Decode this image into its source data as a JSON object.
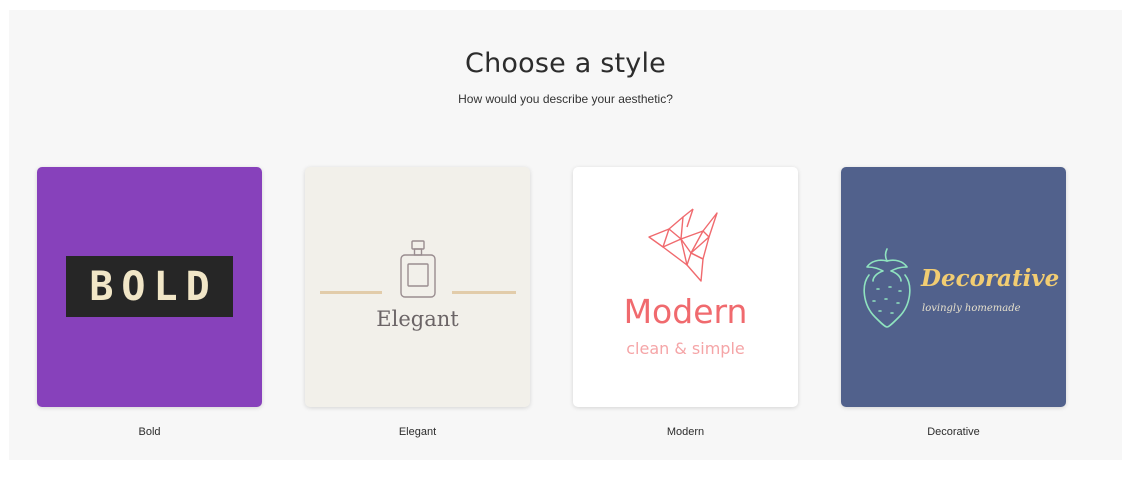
{
  "header": {
    "title": "Choose a style",
    "subtitle": "How would you describe your aesthetic?"
  },
  "styles": [
    {
      "label": "Bold",
      "logo_text": "BOLD",
      "background": "#8741bb",
      "icon": "none"
    },
    {
      "label": "Elegant",
      "logo_text": "Elegant",
      "background": "#f2f0ea",
      "icon": "perfume-bottle-icon"
    },
    {
      "label": "Modern",
      "logo_text": "Modern",
      "tagline": "clean & simple",
      "background": "#ffffff",
      "icon": "origami-bird-icon"
    },
    {
      "label": "Decorative",
      "logo_text": "Decorative",
      "tagline": "lovingly homemade",
      "background": "#51618c",
      "icon": "strawberry-icon"
    }
  ]
}
